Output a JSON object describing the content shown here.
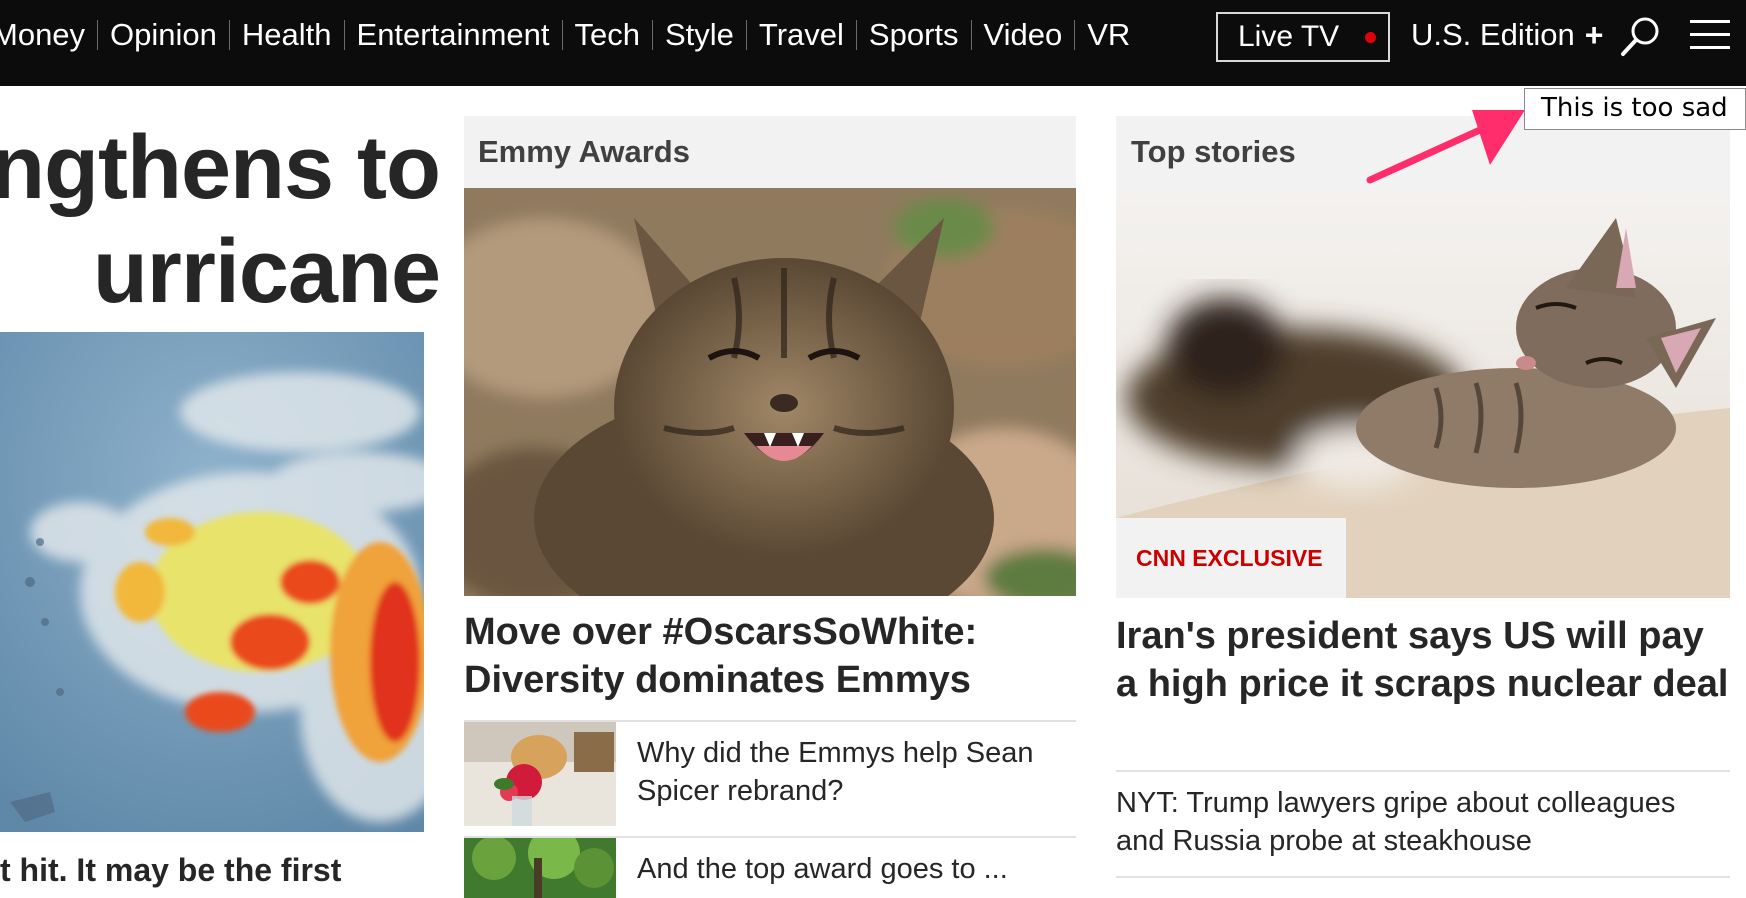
{
  "nav": {
    "items": [
      "Money",
      "Opinion",
      "Health",
      "Entertainment",
      "Tech",
      "Style",
      "Travel",
      "Sports",
      "Video",
      "VR"
    ],
    "live_tv_label": "Live TV",
    "edition_label": "U.S. Edition",
    "edition_plus": "+"
  },
  "lead": {
    "headline_line1": "ngthens to",
    "headline_line2": "urricane",
    "caption": "t hit. It may be the first"
  },
  "emmy": {
    "section_title": "Emmy Awards",
    "headline": "Move over #OscarsSoWhite: Diversity dominates Emmys",
    "stories": [
      {
        "text": "Why did the Emmys help Sean Spicer rebrand?"
      },
      {
        "text": "And the top award goes to ..."
      }
    ]
  },
  "top": {
    "section_title": "Top stories",
    "badge": "CNN EXCLUSIVE",
    "headline": "Iran's president says US will pay a high price it scraps nuclear deal",
    "stories": [
      {
        "text": "NYT: Trump lawyers gripe about colleagues and Russia probe at steakhouse"
      }
    ]
  },
  "annotation": {
    "text": "This is too sad"
  },
  "colors": {
    "nav_bg": "#0c0c0c",
    "live_dot": "#e0000a",
    "exclusive_red": "#cc0000",
    "annotation_arrow": "#ff2d6b"
  },
  "icons": {
    "search": "search-icon",
    "menu": "hamburger-menu-icon"
  }
}
